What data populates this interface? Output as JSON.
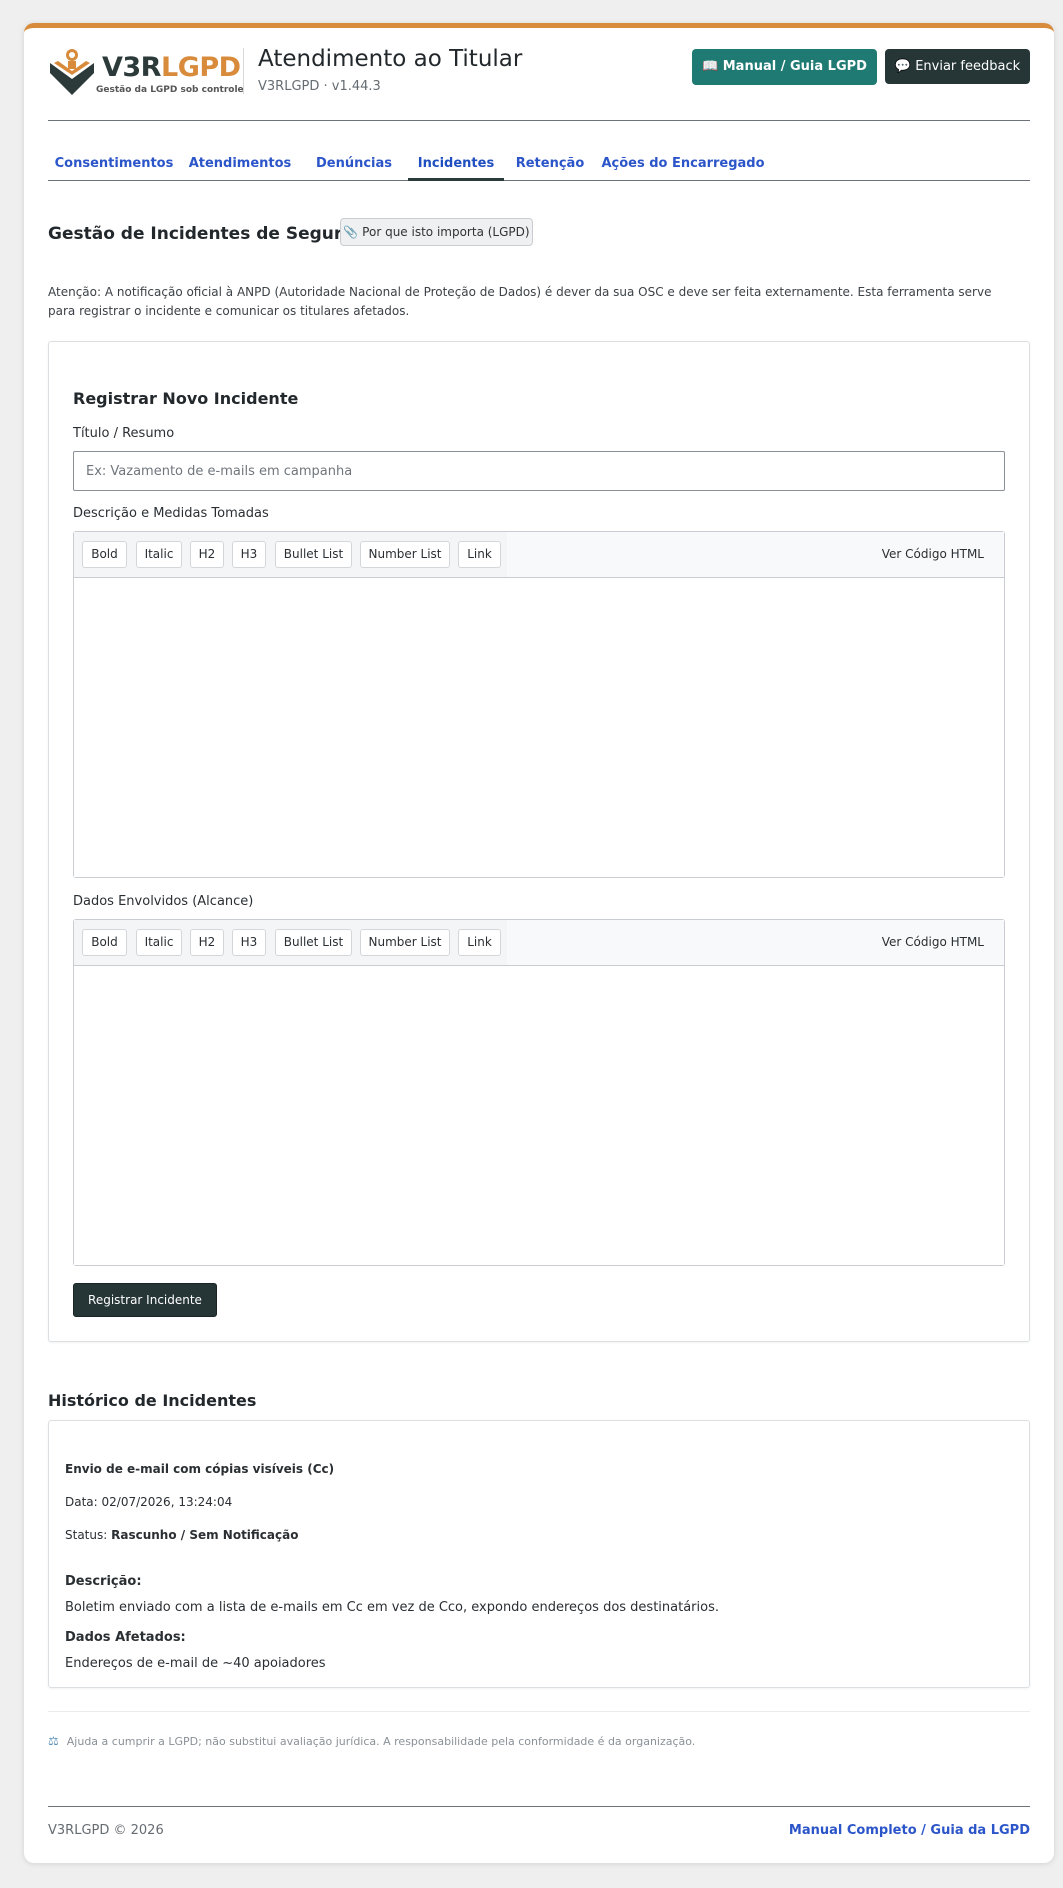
{
  "header": {
    "logo": {
      "wordmark_a": "V3R",
      "wordmark_b": "LGPD",
      "tagline": "Gestão da LGPD sob controle"
    },
    "title": "Atendimento ao Titular",
    "version": "V3RLGPD · v1.44.3",
    "manual_button": "📖 Manual / Guia LGPD",
    "feedback_button": "💬 Enviar feedback"
  },
  "tabs": [
    {
      "label": "Consentimentos"
    },
    {
      "label": "Atendimentos"
    },
    {
      "label": "Denúncias"
    },
    {
      "label": "Incidentes",
      "active": true
    },
    {
      "label": "Retenção"
    },
    {
      "label": "Ações do Encarregado"
    }
  ],
  "section": {
    "title": "Gestão de Incidentes de Segurança",
    "why_button": "📎 Por que isto importa (LGPD)",
    "notice": "Atenção: A notificação oficial à ANPD (Autoridade Nacional de Proteção de Dados) é dever da sua OSC e deve ser feita externamente. Esta ferramenta serve para registrar o incidente e comunicar os titulares afetados."
  },
  "form": {
    "title": "Registrar Novo Incidente",
    "title_label": "Título / Resumo",
    "title_placeholder": "Ex: Vazamento de e-mails em campanha",
    "description_label": "Descrição e Medidas Tomadas",
    "data_label": "Dados Envolvidos (Alcance)",
    "toolbar": [
      "Bold",
      "Italic",
      "H2",
      "H3",
      "Bullet List",
      "Number List",
      "Link"
    ],
    "view_html": "Ver Código HTML",
    "submit": "Registrar Incidente"
  },
  "history": {
    "title": "Histórico de Incidentes",
    "items": [
      {
        "title": "Envio de e-mail com cópias visíveis (Cc)",
        "date_label": "Data:",
        "date": "02/07/2026, 13:24:04",
        "status_label": "Status:",
        "status": "Rascunho / Sem Notificação",
        "description_label": "Descrição:",
        "description": "Boletim enviado com a lista de e-mails em Cc em vez de Cco, expondo endereços dos destinatários.",
        "data_label": "Dados Afetados:",
        "data": "Endereços de e-mail de ~40 apoiadores"
      }
    ]
  },
  "disclaimer": "Ajuda a cumprir a LGPD; não substitui avaliação jurídica. A responsabilidade pela conformidade é da organização.",
  "footer": {
    "copyright": "V3RLGPD © 2026",
    "link": "Manual Completo / Guia da LGPD"
  },
  "colors": {
    "accent": "#d88b3a",
    "primary_teal": "#1e7a72",
    "dark": "#263536",
    "link": "#2b55c9"
  }
}
